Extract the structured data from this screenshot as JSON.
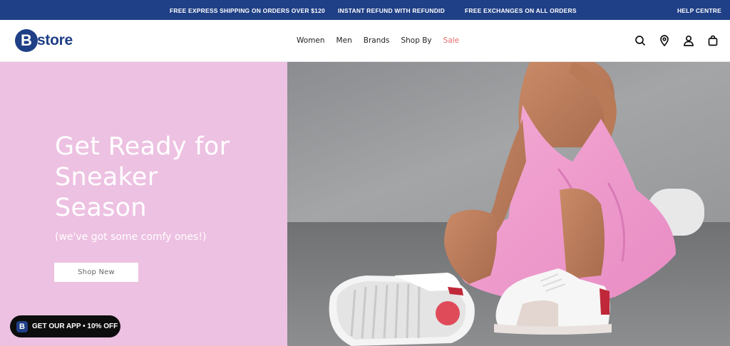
{
  "announcement": {
    "item1": "FREE EXPRESS SHIPPING ON ORDERS OVER $120",
    "item2": "INSTANT REFUND WITH REFUNDID",
    "item3": "FREE EXCHANGES ON ALL ORDERS",
    "help": "HELP CENTRE"
  },
  "header": {
    "logo_letter": "B",
    "logo_text": "store",
    "nav": [
      "Women",
      "Men",
      "Brands",
      "Shop By",
      "Sale"
    ],
    "icons": [
      "search-icon",
      "location-icon",
      "account-icon",
      "bag-icon"
    ]
  },
  "hero": {
    "title_line1": "Get Ready for",
    "title_line2": "Sneaker",
    "title_line3": "Season",
    "subtitle": "(we've got some comfy ones!)",
    "button": "Shop New",
    "background_color": "#edc1e2"
  },
  "app_badge": {
    "icon_letter": "B",
    "text": "GET OUR APP • 10% OFF"
  },
  "colors": {
    "brand": "#1f3f86",
    "sale": "#e66a6a",
    "hero_pink": "#edc1e2"
  }
}
